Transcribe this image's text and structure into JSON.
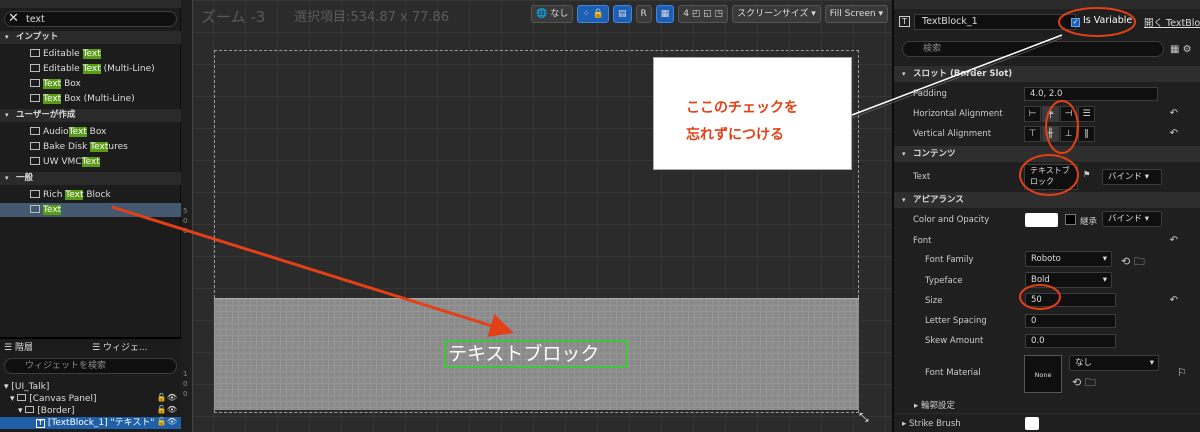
{
  "left": {
    "search": {
      "value": "text"
    },
    "categories": [
      {
        "label": "インプット",
        "items": [
          {
            "pre": "Editable ",
            "hl": "Text",
            "post": ""
          },
          {
            "pre": "Editable ",
            "hl": "Text",
            "post": " (Multi-Line)"
          },
          {
            "pre": "",
            "hl": "Text",
            "post": " Box"
          },
          {
            "pre": "",
            "hl": "Text",
            "post": " Box (Multi-Line)"
          }
        ]
      },
      {
        "label": "ユーザーが作成",
        "items": [
          {
            "pre": "Audio",
            "hl": "Text",
            "post": " Box"
          },
          {
            "pre": "Bake Disk ",
            "hl": "Text",
            "post": "ures"
          },
          {
            "pre": "UW VMC",
            "hl": "Text",
            "post": ""
          }
        ]
      },
      {
        "label": "一般",
        "items": [
          {
            "pre": "Rich ",
            "hl": "Text",
            "post": " Block"
          },
          {
            "pre": "",
            "hl": "Text",
            "post": ""
          }
        ]
      }
    ]
  },
  "hierarchy": {
    "tab1": "階層",
    "tab2": "ウィジェ...",
    "search_placeholder": "ウィジェットを検索",
    "rows": [
      "[UI_Talk]",
      "[Canvas Panel]",
      "[Border]",
      "[TextBlock_1] \"テキスト\""
    ]
  },
  "viewport": {
    "zoom": "ズーム -3",
    "selection": "選択項目:534.87 x 77.86",
    "toolbar": {
      "none": "なし",
      "r": "R",
      "grid": "4",
      "screen_size": "スクリーンサイズ",
      "fill": "Fill Screen"
    },
    "textblock": "テキストブロック",
    "ruler": [
      "5",
      "0",
      "0",
      "1",
      "0",
      "0"
    ]
  },
  "annotation": {
    "line1": "ここのチェックを",
    "line2": "忘れずにつける"
  },
  "details": {
    "name": "TextBlock_1",
    "is_variable": "Is Variable",
    "open": "開く TextBlock",
    "search_placeholder": "検索",
    "slot": {
      "header": "スロット (Border Slot)",
      "padding_label": "Padding",
      "padding": "4.0, 2.0",
      "halign": "Horizontal Alignment",
      "valign": "Vertical Alignment"
    },
    "content": {
      "header": "コンテンツ",
      "text_label": "Text",
      "text_value": "テキストブ\nロック",
      "bind": "バインド"
    },
    "appearance": {
      "header": "アピアランス",
      "color_label": "Color and Opacity",
      "inherit": "継承",
      "bind": "バインド",
      "font": "Font",
      "font_family_label": "Font Family",
      "font_family": "Roboto",
      "typeface_label": "Typeface",
      "typeface": "Bold",
      "size_label": "Size",
      "size": "50",
      "spacing_label": "Letter Spacing",
      "spacing": "0",
      "skew_label": "Skew Amount",
      "skew": "0.0",
      "material_label": "Font Material",
      "material": "なし",
      "none_box": "None",
      "outline": "輪郭設定",
      "strike": "Strike Brush"
    }
  },
  "colors": {
    "accent": "#1d5fb5",
    "highlight": "#5a9b18",
    "annotation": "#e34016",
    "selection": "#44586f"
  }
}
